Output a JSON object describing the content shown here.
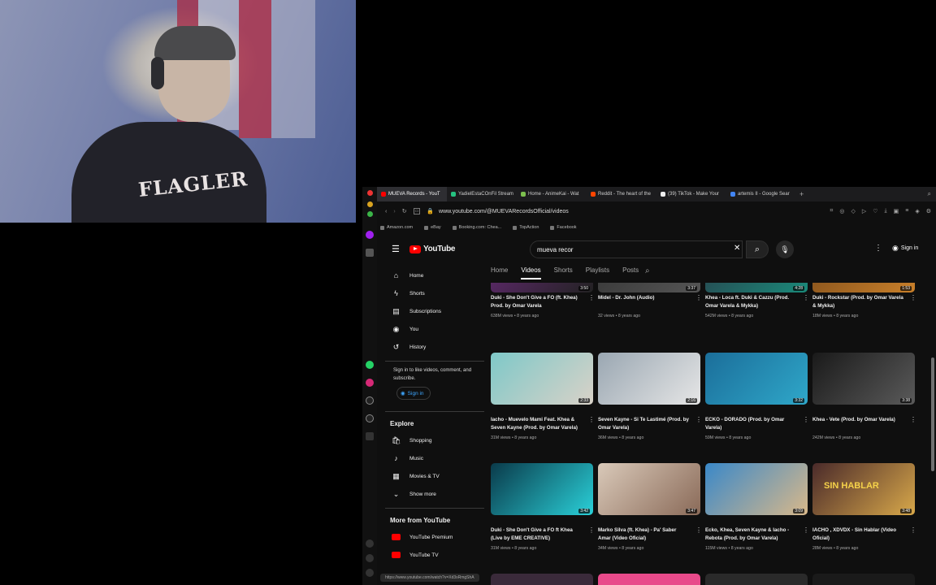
{
  "webcam": {
    "hoodie_text": "FLAGLER"
  },
  "browser": {
    "tabs": [
      {
        "label": "MUEVA Records - YouT",
        "color": "#ff0000",
        "active": true
      },
      {
        "label": "YadielEstaCOnFil Stream",
        "color": "#26c281",
        "active": false
      },
      {
        "label": "Home - AnimeKai - Wat",
        "color": "#7cbf4e",
        "active": false
      },
      {
        "label": "Reddit - The heart of the",
        "color": "#ff4500",
        "active": false
      },
      {
        "label": "(39) TikTok - Make Your",
        "color": "#eeeeee",
        "active": false
      },
      {
        "label": "artemis II - Google Sear",
        "color": "#4285f4",
        "active": false
      }
    ],
    "new_tab": "+",
    "url": "www.youtube.com/@MUEVARecordsOfficial/videos",
    "bookmarks": [
      "Amazon.com",
      "eBay",
      "Booking.com: Chea...",
      "TopAction",
      "Facebook"
    ],
    "status_url": "https://www.youtube.com/watch?v=Xd3sRmgShA"
  },
  "youtube": {
    "logo": "YouTube",
    "search_value": "mueva recor",
    "sign_in": "Sign in",
    "sidebar": {
      "items": [
        {
          "label": "Home",
          "icon": "⌂"
        },
        {
          "label": "Shorts",
          "icon": "ϟ"
        },
        {
          "label": "Subscriptions",
          "icon": "▤"
        },
        {
          "label": "You",
          "icon": "◉"
        },
        {
          "label": "History",
          "icon": "↺"
        }
      ],
      "signin_note": "Sign in to like videos, comment, and subscribe.",
      "signin_button": "Sign in",
      "explore_title": "Explore",
      "explore": [
        {
          "label": "Shopping",
          "icon": "🛍"
        },
        {
          "label": "Music",
          "icon": "♪"
        },
        {
          "label": "Movies & TV",
          "icon": "▦"
        },
        {
          "label": "Show more",
          "icon": "⌄"
        }
      ],
      "more_title": "More from YouTube",
      "more": [
        "YouTube Premium",
        "YouTube TV"
      ]
    },
    "channel_tabs": [
      "Home",
      "Videos",
      "Shorts",
      "Playlists",
      "Posts"
    ],
    "videos": [
      {
        "title": "Duki - She Don't Give a FO (ft. Khea) Prod. by Omar Varela",
        "views": "638M views",
        "ago": "8 years ago",
        "duration": "3:50",
        "colors": [
          "#6a2a7a",
          "#222"
        ]
      },
      {
        "title": "Midel - Dr. John (Audio)",
        "views": "32 views",
        "ago": "8 years ago",
        "duration": "3:37",
        "colors": [
          "#333",
          "#555"
        ]
      },
      {
        "title": "Khea - Loca ft. Duki & Cazzu (Prod. Omar Varela & Mykka)",
        "views": "542M views",
        "ago": "8 years ago",
        "duration": "4:28",
        "colors": [
          "#2a3b48",
          "#1a8a7a"
        ]
      },
      {
        "title": "Duki - Rockstar (Prod. by Omar Varela & Mykka)",
        "views": "18M views",
        "ago": "8 years ago",
        "duration": "1:53",
        "colors": [
          "#7a4a1a",
          "#c9802a"
        ]
      },
      {
        "title": "Iacho - Muevelo Mami Feat. Khea & Seven Kayne (Prod. by Omar Varela)",
        "views": "31M views",
        "ago": "8 years ago",
        "duration": "2:33",
        "colors": [
          "#7ec8c8",
          "#d9d2c8"
        ]
      },
      {
        "title": "Seven Kayne - Si Te Lastimé (Prod. by Omar Varela)",
        "views": "36M views",
        "ago": "8 years ago",
        "duration": "2:16",
        "colors": [
          "#9aa7b2",
          "#e6e6e6"
        ]
      },
      {
        "title": "ECKO - DORADO (Prod. by Omar Varela)",
        "views": "59M views",
        "ago": "8 years ago",
        "duration": "3:32",
        "colors": [
          "#1b6e9a",
          "#2fa7c9"
        ]
      },
      {
        "title": "Khea - Vete (Prod. by Omar Varela)",
        "views": "242M views",
        "ago": "8 years ago",
        "duration": "3:38",
        "colors": [
          "#1a1a1a",
          "#5a5a5a"
        ]
      },
      {
        "title": "Duki - She Don't Give a FO ft Khea (Live by EME CREATIVE)",
        "views": "31M views",
        "ago": "8 years ago",
        "duration": "3:42",
        "colors": [
          "#0a3a4a",
          "#2ad0d8"
        ]
      },
      {
        "title": "Marko Silva (ft. Khea) - Pa' Saber Amar (Video Oficial)",
        "views": "34M views",
        "ago": "8 years ago",
        "duration": "3:47",
        "colors": [
          "#d9c9b9",
          "#8a6a58"
        ]
      },
      {
        "title": "Ecko, Khea, Seven Kayne & Iacho - Rebota (Prod. by Omar Varela)",
        "views": "115M views",
        "ago": "8 years ago",
        "duration": "3:09",
        "colors": [
          "#3a88c8",
          "#d8b88a"
        ]
      },
      {
        "title": "IACHO , XDVDX - Sin Hablar (Video Oficial)",
        "views": "28M views",
        "ago": "8 years ago",
        "duration": "3:48",
        "colors": [
          "#4a2a2a",
          "#d8a84a"
        ],
        "overlay": "SIN HABLAR"
      }
    ]
  }
}
